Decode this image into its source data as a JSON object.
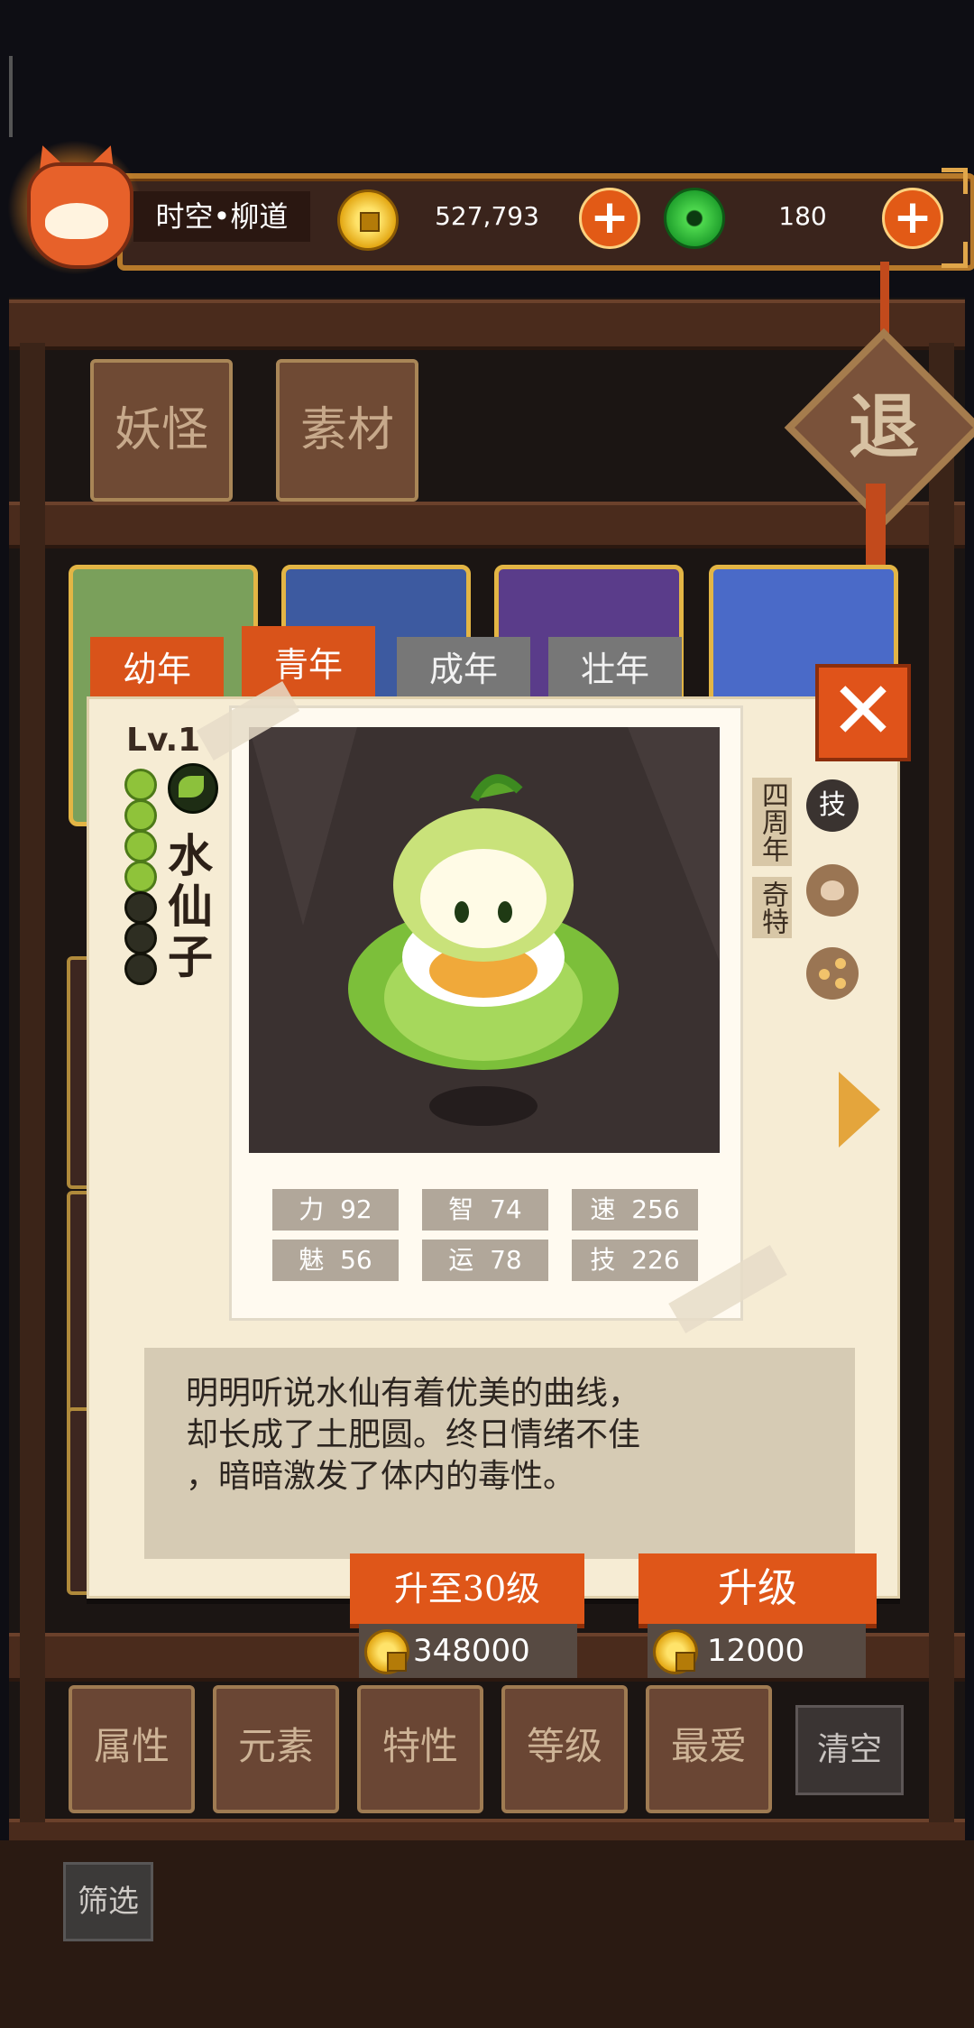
{
  "hud": {
    "player_name": "时空•柳道",
    "gold_amount": "527,793",
    "jade_amount": "180",
    "plus_label": "+"
  },
  "category_tabs": [
    "妖怪",
    "素材"
  ],
  "exit_label": "退",
  "age_tabs": [
    {
      "label": "幼年",
      "active": false
    },
    {
      "label": "青年",
      "active": true
    },
    {
      "label": "成年",
      "active": false
    },
    {
      "label": "壮年",
      "active": false
    }
  ],
  "close_label": "✕",
  "creature": {
    "level": "Lv.1",
    "name_chars": [
      "水",
      "仙",
      "子"
    ],
    "level_dots_filled": 4,
    "level_dots_total": 7,
    "tags": [
      "四周年",
      "奇特"
    ],
    "side_icons": [
      "技",
      "heart-icon",
      "share-icon"
    ],
    "stats": [
      {
        "label": "力",
        "value": "92"
      },
      {
        "label": "智",
        "value": "74"
      },
      {
        "label": "速",
        "value": "256"
      },
      {
        "label": "魅",
        "value": "56"
      },
      {
        "label": "运",
        "value": "78"
      },
      {
        "label": "技",
        "value": "226"
      }
    ],
    "description_lines": [
      "明明听说水仙有着优美的曲线，",
      "却长成了土肥圆。终日情绪不佳",
      "，暗暗激发了体内的毒性。"
    ]
  },
  "upgrade": {
    "to30_label": "升至30级",
    "to30_cost": "348000",
    "upgrade_label": "升级",
    "upgrade_cost": "12000"
  },
  "filters": [
    "属性",
    "元素",
    "特性",
    "等级",
    "最爱"
  ],
  "clear_label": "清空",
  "screen_label": "筛选",
  "colors": {
    "accent_orange": "#df5619",
    "gold": "#e3a713",
    "jade": "#1c9c2a"
  }
}
